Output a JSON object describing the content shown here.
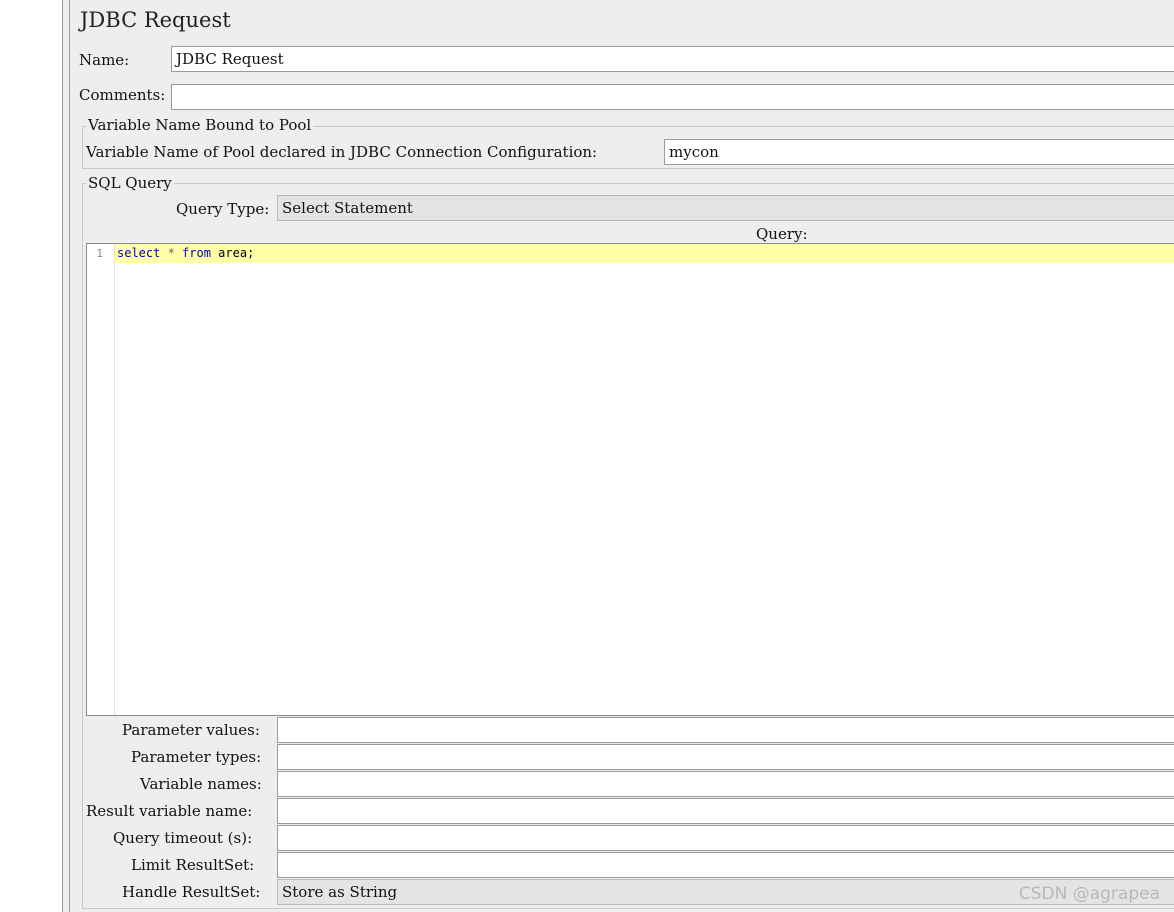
{
  "panel": {
    "title": "JDBC Request",
    "name_label": "Name:",
    "name_value": "JDBC Request",
    "comments_label": "Comments:",
    "comments_value": ""
  },
  "pool_group": {
    "title": "Variable Name Bound to Pool",
    "pool_label": "Variable Name of Pool declared in JDBC Connection Configuration:",
    "pool_value": "mycon"
  },
  "sql_group": {
    "title": "SQL Query",
    "query_type_label": "Query Type:",
    "query_type_value": "Select Statement",
    "query_label": "Query:",
    "editor": {
      "line_number": "1",
      "tokens": {
        "kw1": "select",
        "op": " * ",
        "kw2": "from",
        "rest": " area;"
      }
    }
  },
  "params": [
    {
      "label": "Parameter values:",
      "value": ""
    },
    {
      "label": "Parameter types:",
      "value": ""
    },
    {
      "label": "Variable names:",
      "value": ""
    },
    {
      "label": "Result variable name:",
      "value": ""
    },
    {
      "label": "Query timeout (s):",
      "value": ""
    },
    {
      "label": "Limit ResultSet:",
      "value": ""
    }
  ],
  "handle_resultset": {
    "label": "Handle ResultSet:",
    "value": "Store as String"
  },
  "watermark": "CSDN @agrapea"
}
